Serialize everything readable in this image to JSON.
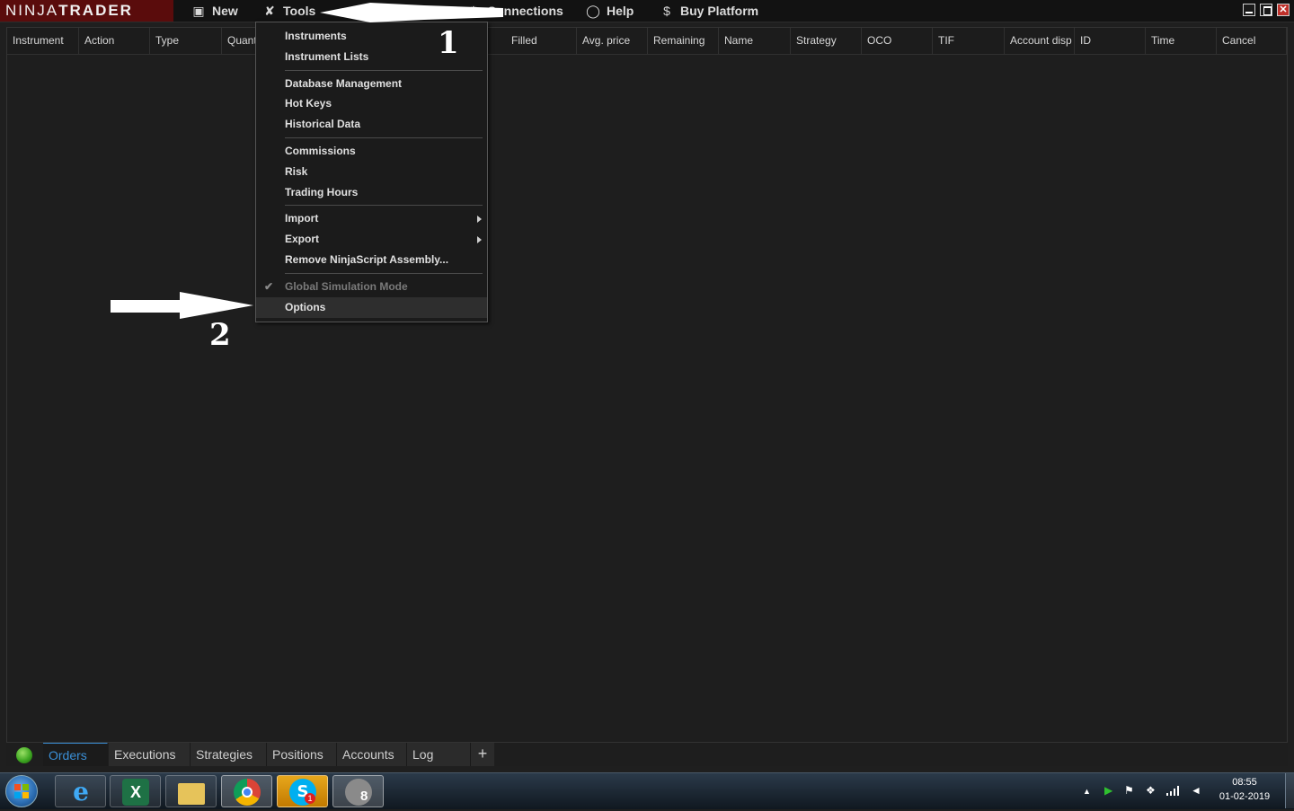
{
  "app": {
    "logo_light": "NINJA",
    "logo_bold": "TRADER"
  },
  "menu": {
    "new": "New",
    "tools": "Tools",
    "connections": "Connections",
    "help": "Help",
    "buy_platform": "Buy Platform"
  },
  "columns": [
    "Instrument",
    "Action",
    "Type",
    "Quant",
    "Filled",
    "Avg. price",
    "Remaining",
    "Name",
    "Strategy",
    "OCO",
    "TIF",
    "Account disp",
    "ID",
    "Time",
    "Cancel"
  ],
  "tools_menu": {
    "items": [
      {
        "label": "Instruments"
      },
      {
        "label": "Instrument Lists"
      },
      {
        "label": "Database Management"
      },
      {
        "label": "Hot Keys"
      },
      {
        "label": "Historical Data"
      },
      {
        "label": "Commissions"
      },
      {
        "label": "Risk"
      },
      {
        "label": "Trading Hours"
      },
      {
        "label": "Import"
      },
      {
        "label": "Export"
      },
      {
        "label": "Remove NinjaScript Assembly..."
      },
      {
        "label": "Global Simulation Mode",
        "checked": true,
        "disabled": true
      },
      {
        "label": "Options",
        "highlighted": true
      }
    ],
    "check_glyph": "✔"
  },
  "annotations": {
    "step1": "1",
    "step2": "2"
  },
  "tabs": [
    "Orders",
    "Executions",
    "Strategies",
    "Positions",
    "Accounts",
    "Log"
  ],
  "active_tab": "Orders",
  "add_tab_label": "+",
  "window_controls": {
    "close": "✕"
  },
  "taskbar": {
    "skype_badge": "1",
    "ninjatrader_badge": "8",
    "clock_time": "08:55",
    "clock_date": "01-02-2019"
  },
  "colors": {
    "logo_bg": "#5a0c0c",
    "active_tab": "#3a8fd6",
    "status_light": "#3ea722"
  }
}
